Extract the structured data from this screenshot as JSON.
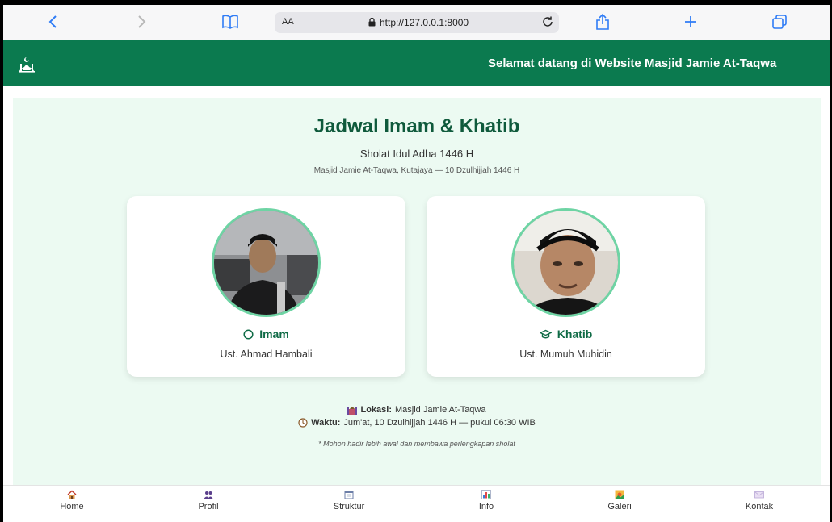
{
  "browser": {
    "aa_label": "AA",
    "url": "http://127.0.0.1:8000"
  },
  "header": {
    "marquee_text": "Selamat datang di Website Masjid Jamie At-Taqwa"
  },
  "main": {
    "title": "Jadwal Imam & Khatib",
    "subtitle": "Sholat Idul Adha 1446 H",
    "meta": "Masjid Jamie At-Taqwa, Kutajaya — 10 Dzulhijjah 1446 H",
    "cards": [
      {
        "role": "Imam",
        "name": "Ust. Ahmad Hambali",
        "icon": "circle-icon"
      },
      {
        "role": "Khatib",
        "name": "Ust. Mumuh Muhidin",
        "icon": "graduation-cap-icon"
      }
    ],
    "lokasi_label": "Lokasi:",
    "lokasi_value": "Masjid Jamie At-Taqwa",
    "waktu_label": "Waktu:",
    "waktu_value": "Jum'at, 10 Dzulhijjah 1446 H — pukul 06:30 WIB",
    "note": "* Mohon hadir lebih awal dan membawa perlengkapan sholat"
  },
  "bottom_nav": [
    {
      "label": "Home",
      "icon": "house-icon"
    },
    {
      "label": "Profil",
      "icon": "people-icon"
    },
    {
      "label": "Struktur",
      "icon": "calendar-icon"
    },
    {
      "label": "Info",
      "icon": "chart-icon"
    },
    {
      "label": "Galeri",
      "icon": "landscape-icon"
    },
    {
      "label": "Kontak",
      "icon": "envelope-icon"
    }
  ],
  "colors": {
    "brand_green": "#0b7a4f",
    "title_green": "#0f5a3c",
    "content_bg": "#ecfaf2",
    "avatar_ring": "#6ed4a4"
  }
}
